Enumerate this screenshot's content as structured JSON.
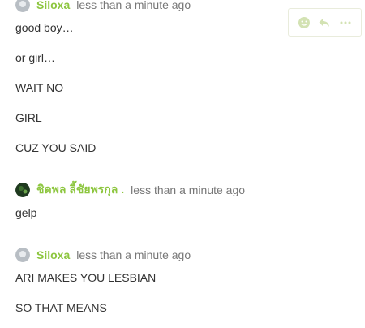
{
  "colors": {
    "author": "#8dc63f",
    "time": "#777777",
    "text": "#333333",
    "divider": "#dddddd",
    "action_icon": "#d3e2b3"
  },
  "comment1": {
    "author": "Siloxa",
    "time": "less than a minute ago",
    "lines": [
      "good boy…",
      "or girl…",
      "WAIT NO",
      "GIRL",
      "CUZ YOU SAID"
    ],
    "actions": [
      "emoji-icon",
      "reply-icon",
      "more-icon"
    ]
  },
  "comment2": {
    "author": "ชิดพล ลี้ชัยพรกุล .",
    "time": "less than a minute ago",
    "lines": [
      "gelp"
    ]
  },
  "comment3": {
    "author": "Siloxa",
    "time": "less than a minute ago",
    "lines": [
      "ARI MAKES YOU LESBIAN",
      "SO THAT MEANS"
    ]
  }
}
